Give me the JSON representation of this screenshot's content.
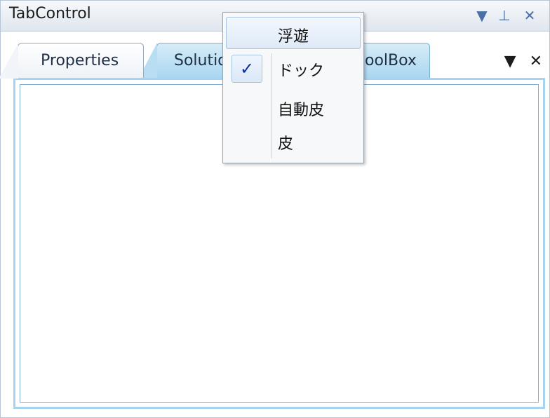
{
  "window": {
    "title": "TabControl",
    "controls": {
      "dropdown_icon": "▼",
      "pin_icon": "⊥",
      "close_icon": "✕"
    }
  },
  "tabs": [
    {
      "label": "Properties",
      "active": true
    },
    {
      "label": "Solutio",
      "active": false
    },
    {
      "label": "oolBox",
      "active": false
    }
  ],
  "tab_strip_controls": {
    "menu_icon": "▼",
    "close_icon": "✕"
  },
  "context_menu": {
    "items": [
      {
        "label": "浮遊",
        "checked": false,
        "highlighted": true
      },
      {
        "label": "ドック",
        "checked": true,
        "highlighted": false
      },
      {
        "label": "自動皮",
        "checked": false,
        "highlighted": false
      },
      {
        "label": "皮",
        "checked": false,
        "highlighted": false
      }
    ],
    "check_mark": "✓"
  },
  "colors": {
    "accent_blue": "#a6d3ef",
    "check_blue": "#0a2aa8"
  }
}
